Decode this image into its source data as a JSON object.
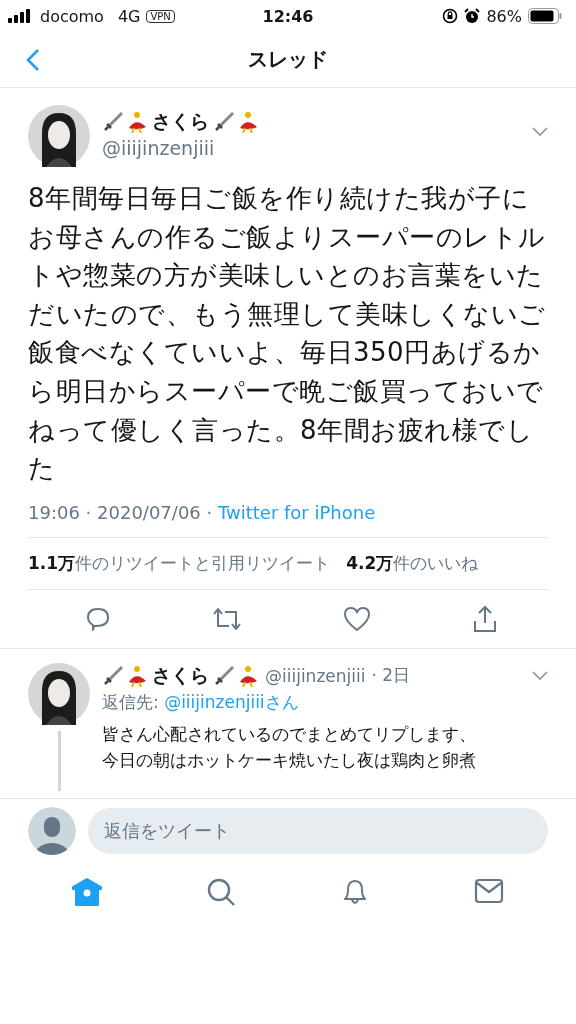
{
  "status_bar": {
    "carrier": "docomo",
    "network": "4G",
    "vpn": "VPN",
    "time": "12:46",
    "battery": "86%"
  },
  "nav": {
    "title": "スレッド"
  },
  "tweet": {
    "name": "さくら",
    "handle": "@iiijinzenjiii",
    "text": "8年間毎日毎日ご飯を作り続けた我が子にお母さんの作るご飯よりスーパーのレトルトや惣菜の方が美味しいとのお言葉をいただいたので、もう無理して美味しくないご飯食べなくていいよ、毎日350円あげるから明日からスーパーで晩ご飯買っておいでねって優しく言った。8年間お疲れ様でした",
    "time": "19:06 · 2020/07/06 · ",
    "source": "Twitter for iPhone",
    "retweets": "1.1万",
    "retweets_label": "件のリツイートと引用リツイート",
    "likes": "4.2万",
    "likes_label": "件のいいね"
  },
  "reply": {
    "name": "さくら",
    "handle": "@iiijinzenjiii",
    "age": "· 2日",
    "reply_to_label": "返信先: ",
    "reply_to": "@iiijinzenjiiiさん",
    "lines": [
      "皆さん心配されているのでまとめてリプします、",
      "今日の朝はホットケーキ焼いたし夜は鶏肉と卵煮"
    ]
  },
  "composer": {
    "placeholder": "返信をツイート"
  },
  "tabs": [
    {
      "kind": "home",
      "selected": true
    },
    {
      "kind": "search",
      "selected": false
    },
    {
      "kind": "notifications",
      "selected": false
    },
    {
      "kind": "messages",
      "selected": false
    }
  ]
}
